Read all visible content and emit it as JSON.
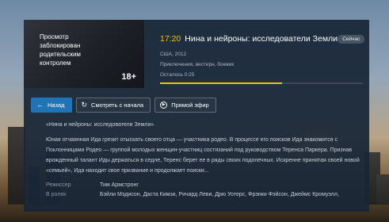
{
  "poster": {
    "blocked_text": "Просмотр заблокирован родительским контролем",
    "age_rating": "18+"
  },
  "program": {
    "time": "17:20",
    "title": "Нина и нейроны: исследователи Земли",
    "now_badge": "Сейчас",
    "country_year": "США, 2012",
    "genres": "Приключения, вестерн, боевик",
    "remaining": "Осталось 0:25",
    "progress": 0.6
  },
  "buttons": {
    "back": "Назад",
    "restart": "Смотреть с начала",
    "live": "Прямой эфир"
  },
  "description": {
    "quote_title": "«Нина и нейроны: исследователи Земли»",
    "body": "Юная отчаянная Ида грезит отыскать своего отца — участника родео. В процессе его поисков Ида знакомится с Поклонницами Родео — группой молодых женщин-участниц состязаний под руководством Теренса Паркера. Признав врожденный талант Иды держаться в седле, Теренс берет ее в ряды своих подопечных. Искренне принятая своей новой «семьей», Ида находит свое призвание и продолжает поиски..."
  },
  "credits": {
    "director_label": "Режиссер",
    "director": "Тим Армстронг",
    "cast_label": "В ролях",
    "cast": "Бэйли Мэдисон, Даста Кимзи, Ричард Леви, Дрю Уотерс, Фрэнки Фэйсон, Джеймс Кромуэлл,"
  },
  "colors": {
    "accent": "#f2c200",
    "button_active": "#1f74b8",
    "panel": "#182637"
  }
}
